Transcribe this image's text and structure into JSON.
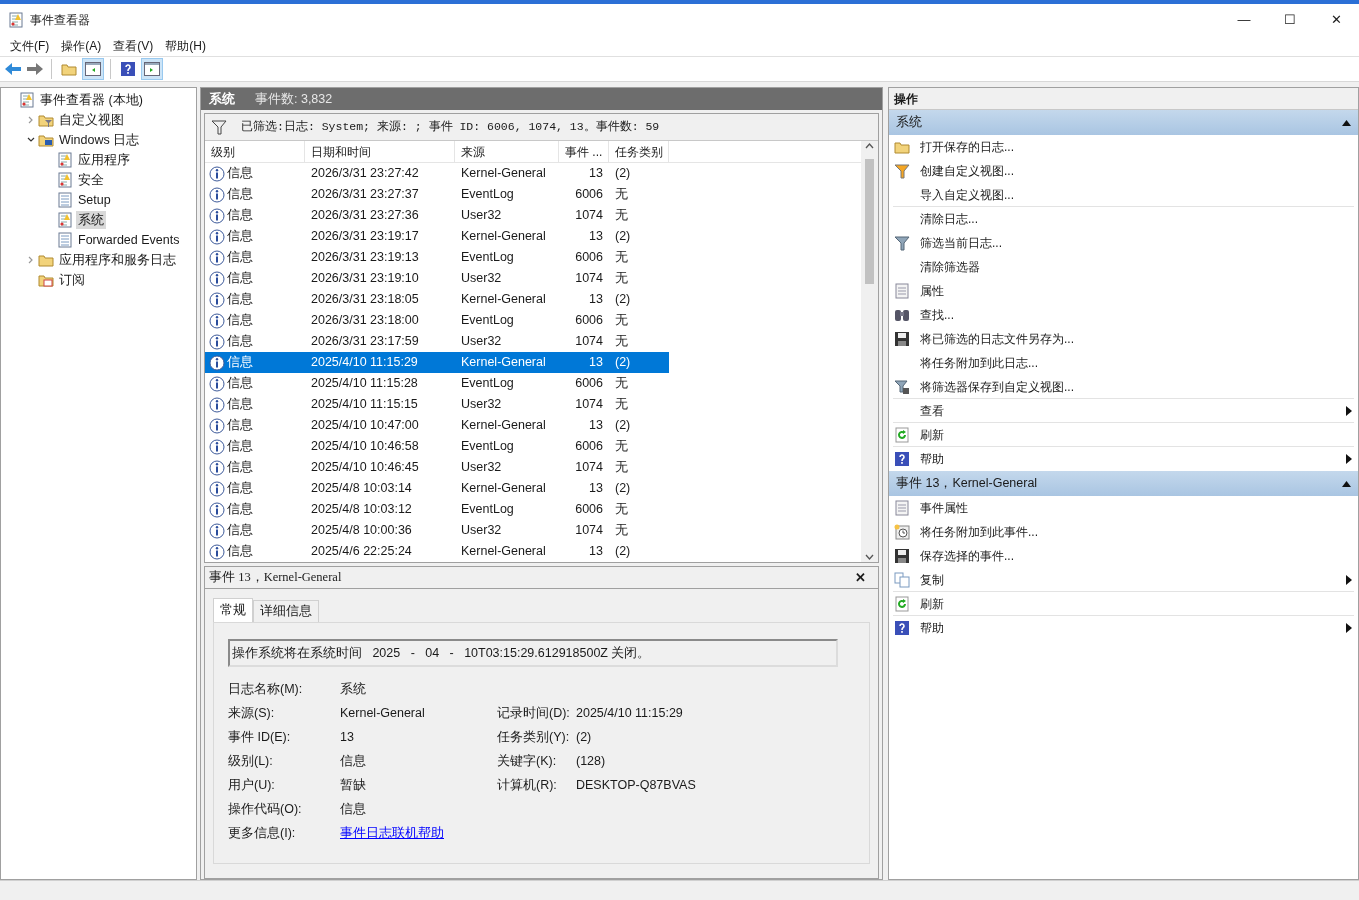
{
  "window": {
    "title": "事件查看器",
    "controls": [
      "—",
      "☐",
      "✕"
    ]
  },
  "menu": [
    "文件(F)",
    "操作(A)",
    "查看(V)",
    "帮助(H)"
  ],
  "toolbar": [
    {
      "kind": "back"
    },
    {
      "kind": "forward"
    },
    {
      "kind": "sep"
    },
    {
      "kind": "up"
    },
    {
      "kind": "pane",
      "selected": true
    },
    {
      "kind": "sep"
    },
    {
      "kind": "help"
    },
    {
      "kind": "pane2",
      "selected": true
    }
  ],
  "tree": [
    {
      "label": "事件查看器 (本地)",
      "kind": "log",
      "selected": false,
      "children": [
        {
          "label": "自定义视图",
          "kind": "folder-filter",
          "expanded": false,
          "selected": false
        },
        {
          "label": "Windows 日志",
          "kind": "folder-pc",
          "expanded": true,
          "selected": false,
          "children": [
            {
              "label": "应用程序",
              "kind": "log",
              "selected": false
            },
            {
              "label": "安全",
              "kind": "log",
              "selected": false
            },
            {
              "label": "Setup",
              "kind": "log-plain",
              "selected": false
            },
            {
              "label": "系统",
              "kind": "log",
              "selected": true
            },
            {
              "label": "Forwarded Events",
              "kind": "log-plain",
              "selected": false
            }
          ]
        },
        {
          "label": "应用程序和服务日志",
          "kind": "folder",
          "expanded": false,
          "selected": false
        },
        {
          "label": "订阅",
          "kind": "folder-sub",
          "selected": false
        }
      ]
    }
  ],
  "log_header": {
    "name": "系统",
    "count": "事件数: 3,832"
  },
  "filter_text": "已筛选:日志: System; 来源: ; 事件 ID: 6006, 1074, 13。事件数: 59",
  "table": {
    "columns": [
      "级别",
      "日期和时间",
      "来源",
      "事件 ...",
      "任务类别"
    ],
    "rows": [
      {
        "level": "信息",
        "datetime": "2026/3/31 23:27:42",
        "source": "Kernel-General",
        "id": "13",
        "category": "(2)",
        "selected": false
      },
      {
        "level": "信息",
        "datetime": "2026/3/31 23:27:37",
        "source": "EventLog",
        "id": "6006",
        "category": "无",
        "selected": false
      },
      {
        "level": "信息",
        "datetime": "2026/3/31 23:27:36",
        "source": "User32",
        "id": "1074",
        "category": "无",
        "selected": false
      },
      {
        "level": "信息",
        "datetime": "2026/3/31 23:19:17",
        "source": "Kernel-General",
        "id": "13",
        "category": "(2)",
        "selected": false
      },
      {
        "level": "信息",
        "datetime": "2026/3/31 23:19:13",
        "source": "EventLog",
        "id": "6006",
        "category": "无",
        "selected": false
      },
      {
        "level": "信息",
        "datetime": "2026/3/31 23:19:10",
        "source": "User32",
        "id": "1074",
        "category": "无",
        "selected": false
      },
      {
        "level": "信息",
        "datetime": "2026/3/31 23:18:05",
        "source": "Kernel-General",
        "id": "13",
        "category": "(2)",
        "selected": false
      },
      {
        "level": "信息",
        "datetime": "2026/3/31 23:18:00",
        "source": "EventLog",
        "id": "6006",
        "category": "无",
        "selected": false
      },
      {
        "level": "信息",
        "datetime": "2026/3/31 23:17:59",
        "source": "User32",
        "id": "1074",
        "category": "无",
        "selected": false
      },
      {
        "level": "信息",
        "datetime": "2025/4/10 11:15:29",
        "source": "Kernel-General",
        "id": "13",
        "category": "(2)",
        "selected": true
      },
      {
        "level": "信息",
        "datetime": "2025/4/10 11:15:28",
        "source": "EventLog",
        "id": "6006",
        "category": "无",
        "selected": false
      },
      {
        "level": "信息",
        "datetime": "2025/4/10 11:15:15",
        "source": "User32",
        "id": "1074",
        "category": "无",
        "selected": false
      },
      {
        "level": "信息",
        "datetime": "2025/4/10 10:47:00",
        "source": "Kernel-General",
        "id": "13",
        "category": "(2)",
        "selected": false
      },
      {
        "level": "信息",
        "datetime": "2025/4/10 10:46:58",
        "source": "EventLog",
        "id": "6006",
        "category": "无",
        "selected": false
      },
      {
        "level": "信息",
        "datetime": "2025/4/10 10:46:45",
        "source": "User32",
        "id": "1074",
        "category": "无",
        "selected": false
      },
      {
        "level": "信息",
        "datetime": "2025/4/8 10:03:14",
        "source": "Kernel-General",
        "id": "13",
        "category": "(2)",
        "selected": false
      },
      {
        "level": "信息",
        "datetime": "2025/4/8 10:03:12",
        "source": "EventLog",
        "id": "6006",
        "category": "无",
        "selected": false
      },
      {
        "level": "信息",
        "datetime": "2025/4/8 10:00:36",
        "source": "User32",
        "id": "1074",
        "category": "无",
        "selected": false
      },
      {
        "level": "信息",
        "datetime": "2025/4/6 22:25:24",
        "source": "Kernel-General",
        "id": "13",
        "category": "(2)",
        "selected": false
      }
    ]
  },
  "detail": {
    "title": "事件 13，Kernel-General",
    "close": "✕",
    "tabs": [
      {
        "label": "常规",
        "selected": true
      },
      {
        "label": "详细信息",
        "selected": false
      }
    ],
    "message": "操作系统将在系统时间   2025   -   04   -   10T03:15:29.612918500Z 关闭。",
    "fields_left": [
      {
        "label": "日志名称(M):",
        "value": "系统"
      },
      {
        "label": "来源(S):",
        "value": "Kernel-General"
      },
      {
        "label": "事件 ID(E):",
        "value": "13"
      },
      {
        "label": "级别(L):",
        "value": "信息"
      },
      {
        "label": "用户(U):",
        "value": "暂缺"
      },
      {
        "label": "操作代码(O):",
        "value": "信息"
      },
      {
        "label": "更多信息(I):",
        "value": "事件日志联机帮助",
        "kind": "link"
      }
    ],
    "fields_right": [
      {
        "label": "记录时间(D):",
        "value": "2025/4/10 11:15:29"
      },
      {
        "label": "任务类别(Y):",
        "value": "(2)"
      },
      {
        "label": "关键字(K):",
        "value": "(128)"
      },
      {
        "label": "计算机(R):",
        "value": "DESKTOP-Q87BVAS"
      }
    ]
  },
  "actions": {
    "title": "操作",
    "sections": [
      {
        "title": "系统",
        "expanded": true,
        "items": [
          {
            "label": "打开保存的日志...",
            "kind": "folder",
            "submenu": false,
            "divider_after": false
          },
          {
            "label": "创建自定义视图...",
            "kind": "filter-color",
            "submenu": false,
            "divider_after": false
          },
          {
            "label": "导入自定义视图...",
            "kind": "none",
            "submenu": false,
            "divider_after": true
          },
          {
            "label": "清除日志...",
            "kind": "none",
            "submenu": false,
            "divider_after": false
          },
          {
            "label": "筛选当前日志...",
            "kind": "filter",
            "submenu": false,
            "divider_after": false
          },
          {
            "label": "清除筛选器",
            "kind": "none",
            "submenu": false,
            "divider_after": false
          },
          {
            "label": "属性",
            "kind": "properties",
            "submenu": false,
            "divider_after": false
          },
          {
            "label": "查找...",
            "kind": "find",
            "submenu": false,
            "divider_after": false
          },
          {
            "label": "将已筛选的日志文件另存为...",
            "kind": "save",
            "submenu": false,
            "divider_after": false
          },
          {
            "label": "将任务附加到此日志...",
            "kind": "none",
            "submenu": false,
            "divider_after": false
          },
          {
            "label": "将筛选器保存到自定义视图...",
            "kind": "filter-save",
            "submenu": false,
            "divider_after": true
          },
          {
            "label": "查看",
            "kind": "none",
            "submenu": true,
            "divider_after": true
          },
          {
            "label": "刷新",
            "kind": "refresh",
            "submenu": false,
            "divider_after": true
          },
          {
            "label": "帮助",
            "kind": "help",
            "submenu": true,
            "divider_after": false
          }
        ]
      },
      {
        "title": "事件 13，Kernel-General",
        "expanded": true,
        "items": [
          {
            "label": "事件属性",
            "kind": "properties",
            "submenu": false,
            "divider_after": false
          },
          {
            "label": "将任务附加到此事件...",
            "kind": "clock",
            "submenu": false,
            "divider_after": false
          },
          {
            "label": "保存选择的事件...",
            "kind": "save",
            "submenu": false,
            "divider_after": false
          },
          {
            "label": "复制",
            "kind": "copy",
            "submenu": true,
            "divider_after": true
          },
          {
            "label": "刷新",
            "kind": "refresh",
            "submenu": false,
            "divider_after": true
          },
          {
            "label": "帮助",
            "kind": "help",
            "submenu": true,
            "divider_after": false
          }
        ]
      }
    ]
  }
}
